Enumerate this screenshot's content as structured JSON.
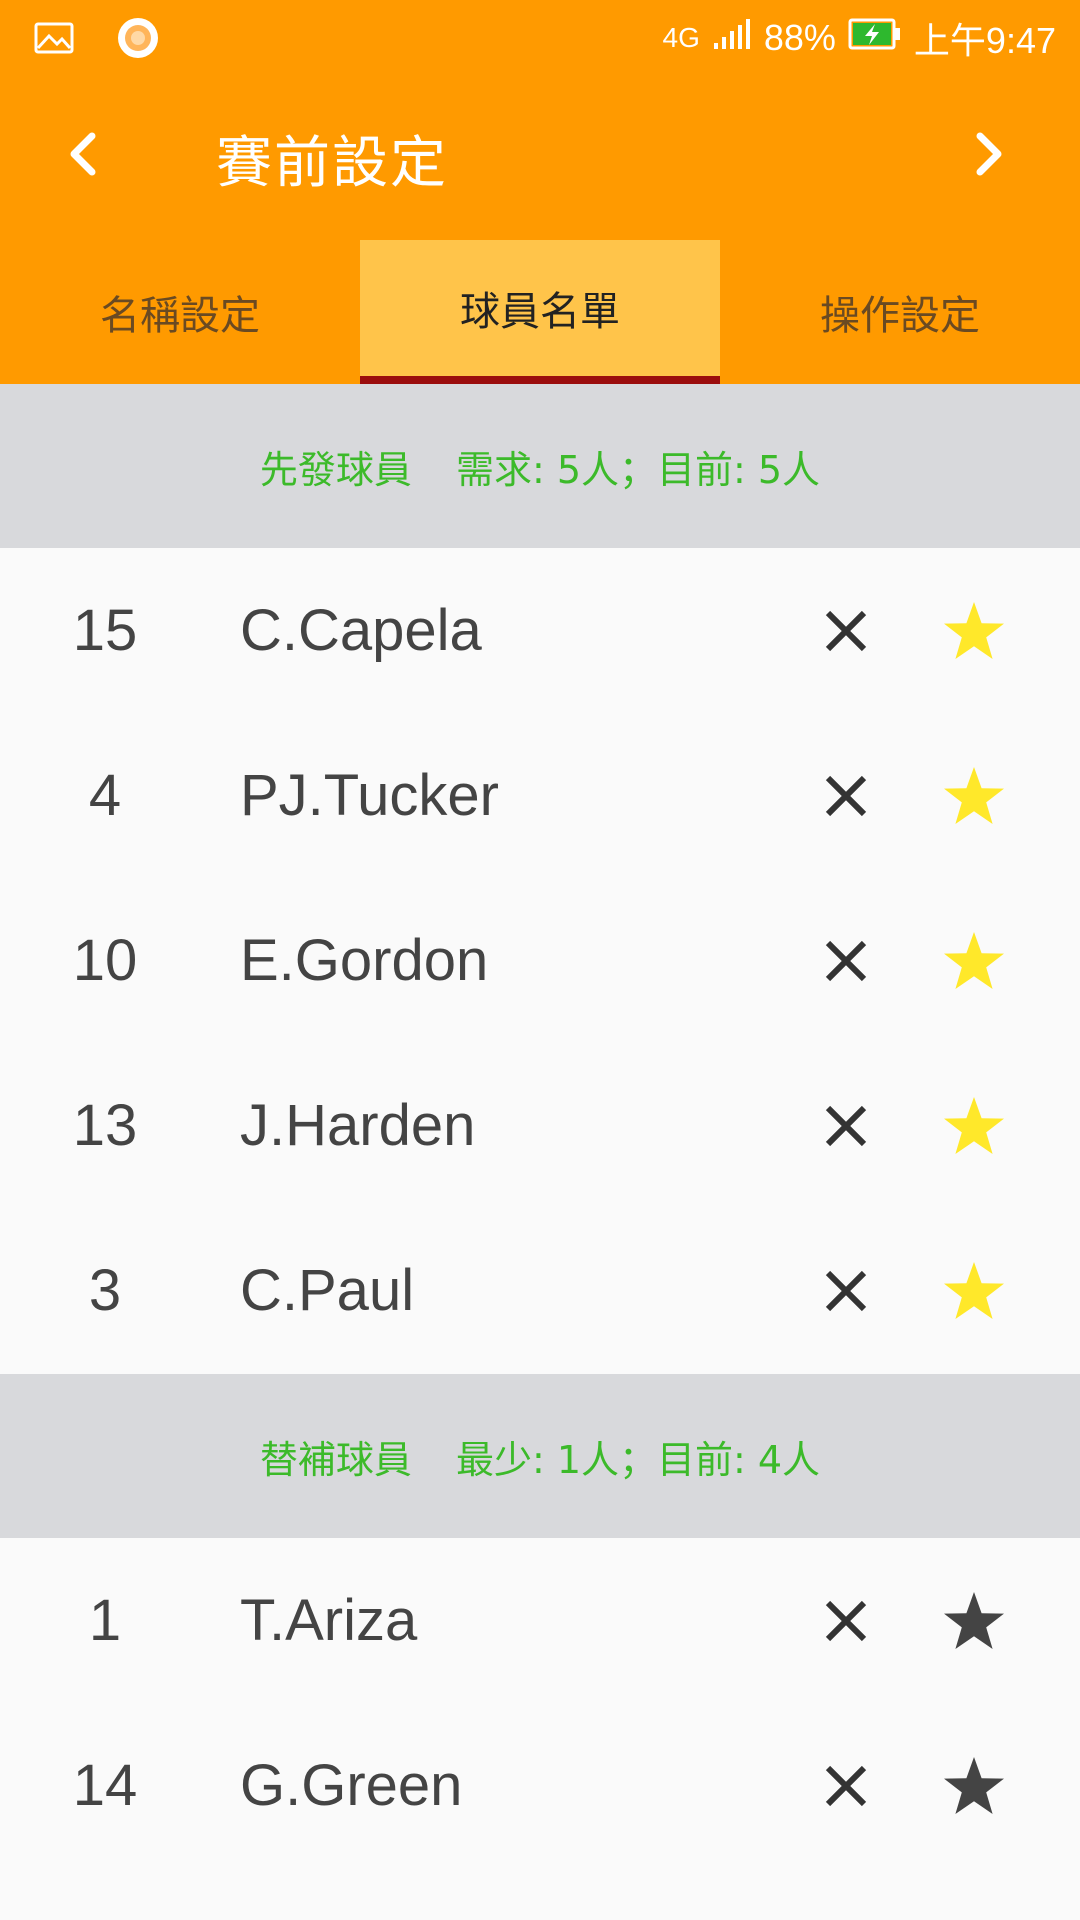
{
  "status_bar": {
    "icons": [
      "gallery-icon",
      "app-notification-icon",
      "network-4g-icon",
      "signal-icon",
      "battery-charging-icon"
    ],
    "network": "4G",
    "battery": "88%",
    "time": "上午9:47"
  },
  "app_bar": {
    "title": "賽前設定",
    "back_icon": "chevron-left-icon",
    "forward_icon": "chevron-right-icon"
  },
  "tabs": [
    {
      "label": "名稱設定",
      "active": false
    },
    {
      "label": "球員名單",
      "active": true
    },
    {
      "label": "操作設定",
      "active": false
    }
  ],
  "starters": {
    "title": "先發球員",
    "requirement": "需求: 5人；目前: 5人",
    "players": [
      {
        "number": "15",
        "name": "C.Capela",
        "starred": true
      },
      {
        "number": "4",
        "name": "PJ.Tucker",
        "starred": true
      },
      {
        "number": "10",
        "name": "E.Gordon",
        "starred": true
      },
      {
        "number": "13",
        "name": "J.Harden",
        "starred": true
      },
      {
        "number": "3",
        "name": "C.Paul",
        "starred": true
      }
    ]
  },
  "bench": {
    "title": "替補球員",
    "requirement": "最少: 1人；目前: 4人",
    "players": [
      {
        "number": "1",
        "name": "T.Ariza",
        "starred": false
      },
      {
        "number": "14",
        "name": "G.Green",
        "starred": false
      }
    ]
  },
  "colors": {
    "primary": "#ff9a00",
    "active_tab": "#ffc44a",
    "tab_indicator": "#9b0d0d",
    "section_bg": "#d8d9dc",
    "section_text": "#3cba2a",
    "star_on": "#ffe82a",
    "star_off": "#444444"
  }
}
